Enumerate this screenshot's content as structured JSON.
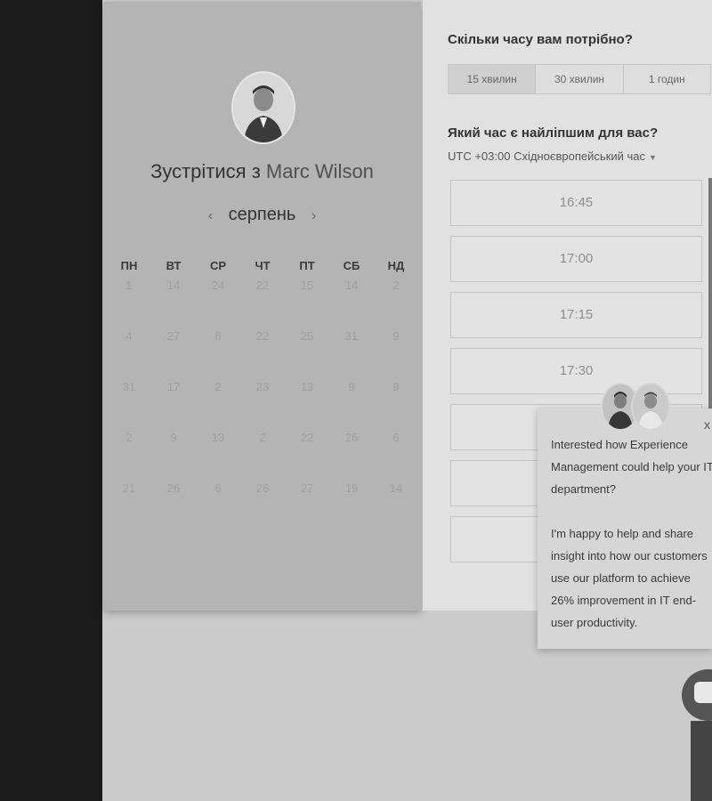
{
  "host": {
    "title_prefix": "Зустрітися з",
    "name": "Marc Wilson"
  },
  "calendar": {
    "month": "серпень",
    "prev_label": "‹",
    "next_label": "›",
    "weekdays": [
      "ПН",
      "ВТ",
      "СР",
      "ЧТ",
      "ПТ",
      "СБ",
      "НД"
    ],
    "days": [
      [
        "1",
        "14",
        "24",
        "22",
        "15",
        "14",
        "2"
      ],
      [
        "4",
        "27",
        "8",
        "22",
        "25",
        "31",
        "9"
      ],
      [
        "31",
        "17",
        "2",
        "23",
        "13",
        "9",
        "9"
      ],
      [
        "2",
        "9",
        "13",
        "2",
        "22",
        "26",
        "6"
      ],
      [
        "21",
        "26",
        "6",
        "26",
        "27",
        "19",
        "14"
      ]
    ]
  },
  "duration": {
    "question": "Скільки часу вам потрібно?",
    "options": [
      "15 хвилин",
      "30 хвилин",
      "1 годин"
    ],
    "selected": "15 хвилин"
  },
  "time": {
    "question": "Який час є найліпшим для вас?",
    "timezone": "UTC +03:00 Східноєвропейський час",
    "slots": [
      "16:45",
      "17:00",
      "17:15",
      "17:30",
      "",
      "",
      ""
    ]
  },
  "chat": {
    "close_label": "x",
    "message_1": "Interested how Experience Management could help your IT department?",
    "message_2": "I'm happy to help and share insight into how our customers use our platform to achieve 26% improvement in IT end-user productivity."
  },
  "icons": {
    "host_avatar": "person-avatar-icon",
    "chat_avatars": "agent-avatar-icon",
    "launcher": "chat-bubble-icon"
  },
  "colors": {
    "left_panel": "#b4b4b4",
    "right_panel": "#e1e1e1",
    "sidebar": "#1b1b1b"
  }
}
